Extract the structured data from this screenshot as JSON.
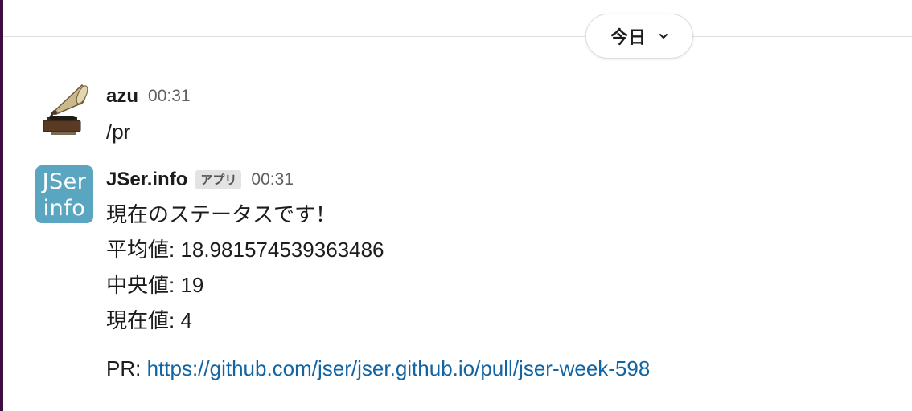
{
  "date_divider": {
    "label": "今日",
    "icon": "chevron-down-icon"
  },
  "messages": [
    {
      "author": "azu",
      "time": "00:31",
      "avatar": "gramophone-avatar",
      "text": "/pr"
    },
    {
      "author": "JSer.info",
      "badge": "アプリ",
      "time": "00:31",
      "avatar_text": [
        "JSer",
        "info"
      ],
      "lines": [
        "現在のステータスです！",
        "平均値: 18.981574539363486",
        "中央値: 19",
        "現在値: 4"
      ],
      "pr_label": "PR: ",
      "pr_link": "https://github.com/jser/jser.github.io/pull/jser-week-598"
    }
  ],
  "colors": {
    "link": "#1264a3",
    "avatar_bg": "#5aa6c0",
    "sidebar_edge": "#3f0e40"
  }
}
